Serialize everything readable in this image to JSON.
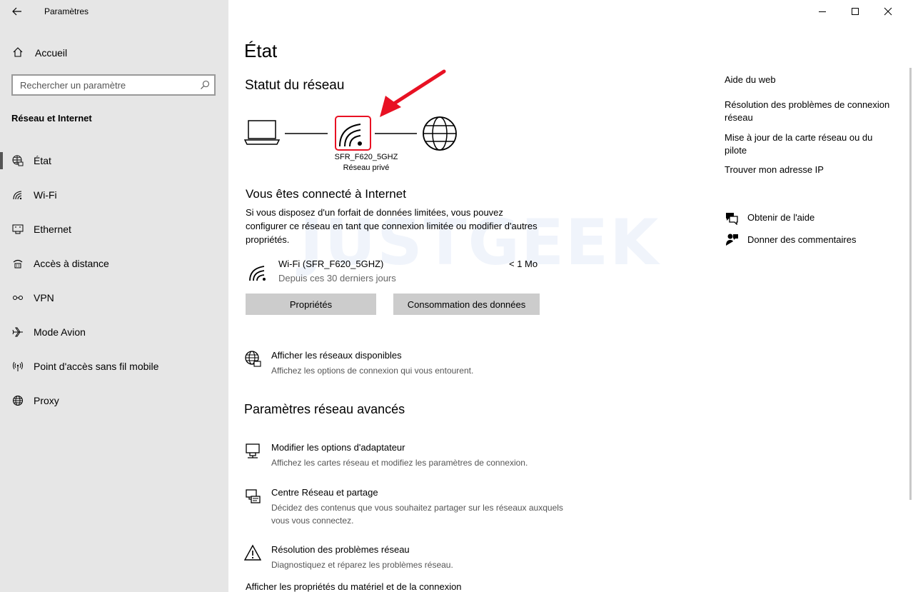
{
  "window": {
    "title": "Paramètres"
  },
  "sidebar": {
    "home_label": "Accueil",
    "search_placeholder": "Rechercher un paramètre",
    "section_title": "Réseau et Internet",
    "items": [
      {
        "label": "État",
        "icon": "globe-network-icon",
        "active": true
      },
      {
        "label": "Wi-Fi",
        "icon": "wifi-icon"
      },
      {
        "label": "Ethernet",
        "icon": "ethernet-icon"
      },
      {
        "label": "Accès à distance",
        "icon": "dial-up-icon"
      },
      {
        "label": "VPN",
        "icon": "vpn-icon"
      },
      {
        "label": "Mode Avion",
        "icon": "airplane-icon"
      },
      {
        "label": "Point d'accès sans fil mobile",
        "icon": "hotspot-icon"
      },
      {
        "label": "Proxy",
        "icon": "globe-icon"
      }
    ]
  },
  "main": {
    "title": "État",
    "status_heading": "Statut du réseau",
    "network": {
      "name": "SFR_F620_5GHZ",
      "type": "Réseau privé"
    },
    "connected_title": "Vous êtes connecté à Internet",
    "connected_desc": "Si vous disposez d'un forfait de données limitées, vous pouvez configurer ce réseau en tant que connexion limitée ou modifier d'autres propriétés.",
    "watermark": "JUSTGEEK",
    "usage": {
      "name": "Wi-Fi (SFR_F620_5GHZ)",
      "period": "Depuis ces 30 derniers jours",
      "amount": "< 1 Mo"
    },
    "buttons": {
      "properties": "Propriétés",
      "data_usage": "Consommation des données"
    },
    "available_networks": {
      "title": "Afficher les réseaux disponibles",
      "desc": "Affichez les options de connexion qui vous entourent."
    },
    "advanced_heading": "Paramètres réseau avancés",
    "advanced_items": [
      {
        "title": "Modifier les options d'adaptateur",
        "desc": "Affichez les cartes réseau et modifiez les paramètres de connexion.",
        "icon": "adapter-icon"
      },
      {
        "title": "Centre Réseau et partage",
        "desc": "Décidez des contenus que vous souhaitez partager sur les réseaux auxquels vous vous connectez.",
        "icon": "sharing-icon"
      },
      {
        "title": "Résolution des problèmes réseau",
        "desc": "Diagnostiquez et réparez les problèmes réseau.",
        "icon": "warning-icon"
      }
    ],
    "hardware_link": "Afficher les propriétés du matériel et de la connexion"
  },
  "right": {
    "help_title": "Aide du web",
    "links": [
      "Résolution des problèmes de connexion réseau",
      "Mise à jour de la carte réseau ou du pilote",
      "Trouver mon adresse IP"
    ],
    "get_help": "Obtenir de l'aide",
    "feedback": "Donner des commentaires"
  },
  "colors": {
    "sidebar_bg": "#e6e6e6",
    "highlight_red": "#e81123",
    "button_bg": "#cccccc"
  }
}
